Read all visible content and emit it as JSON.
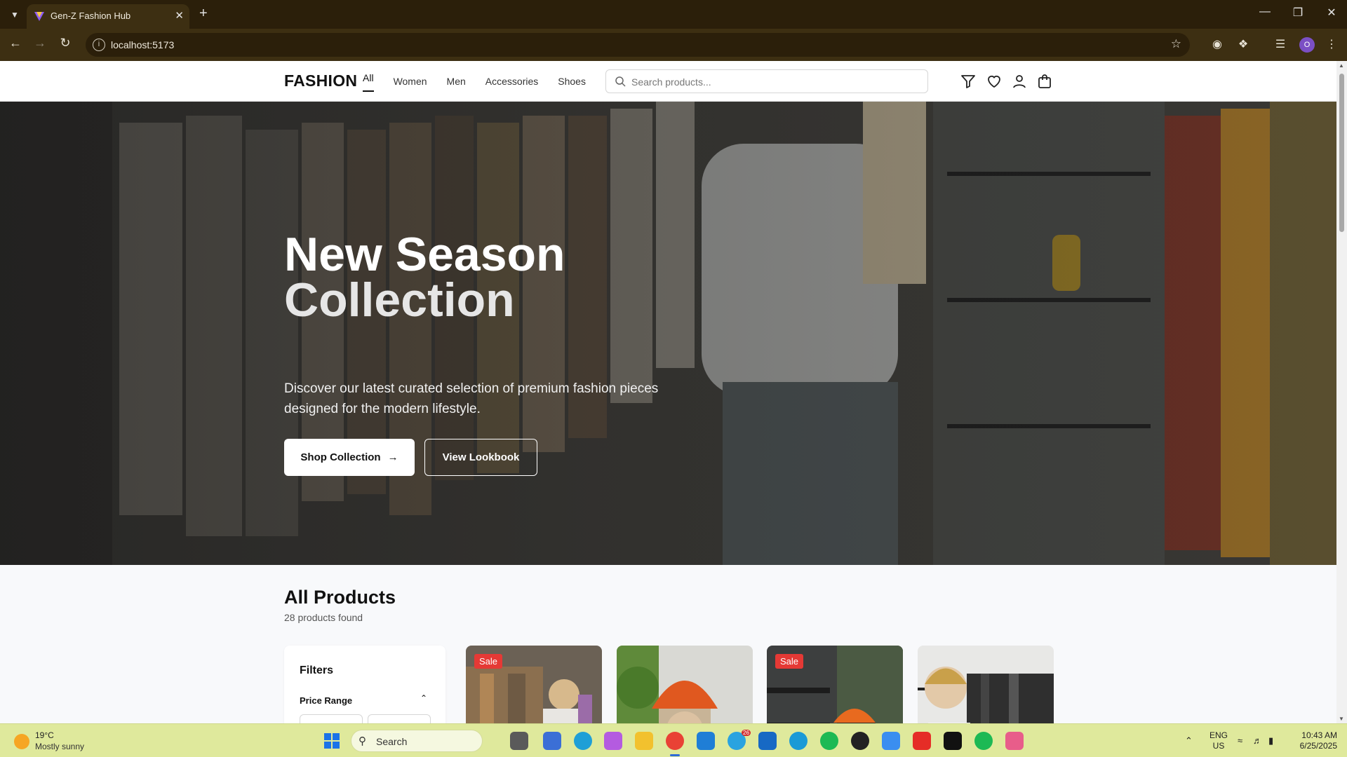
{
  "browser": {
    "tab_title": "Gen-Z Fashion Hub",
    "url": "localhost:5173",
    "profile_initial": "O"
  },
  "header": {
    "logo": "FASHION",
    "nav": [
      "All",
      "Women",
      "Men",
      "Accessories",
      "Shoes"
    ],
    "active_nav": "All",
    "search_placeholder": "Search products...",
    "icons": [
      "filter-icon",
      "heart-icon",
      "user-icon",
      "cart-icon"
    ]
  },
  "hero": {
    "title_line1": "New Season",
    "title_line2": "Collection",
    "description": "Discover our latest curated selection of premium fashion pieces designed for the modern lifestyle.",
    "primary_button": "Shop Collection",
    "secondary_button": "View Lookbook"
  },
  "products": {
    "title": "All Products",
    "count_text": "28 products found",
    "filters_title": "Filters",
    "price_range_label": "Price Range",
    "cards": [
      {
        "badge": "Sale"
      },
      {
        "badge": ""
      },
      {
        "badge": "Sale"
      },
      {
        "badge": ""
      }
    ]
  },
  "taskbar": {
    "weather_temp": "19°C",
    "weather_desc": "Mostly sunny",
    "search_label": "Search",
    "telegram_badge": "26",
    "lang_line1": "ENG",
    "lang_line2": "US",
    "time": "10:43 AM",
    "date": "6/25/2025"
  },
  "colors": {
    "browser_frame": "#2b1f0a",
    "browser_toolbar": "#3d2f12",
    "sale_badge": "#e53935",
    "taskbar": "#dfe99c"
  }
}
